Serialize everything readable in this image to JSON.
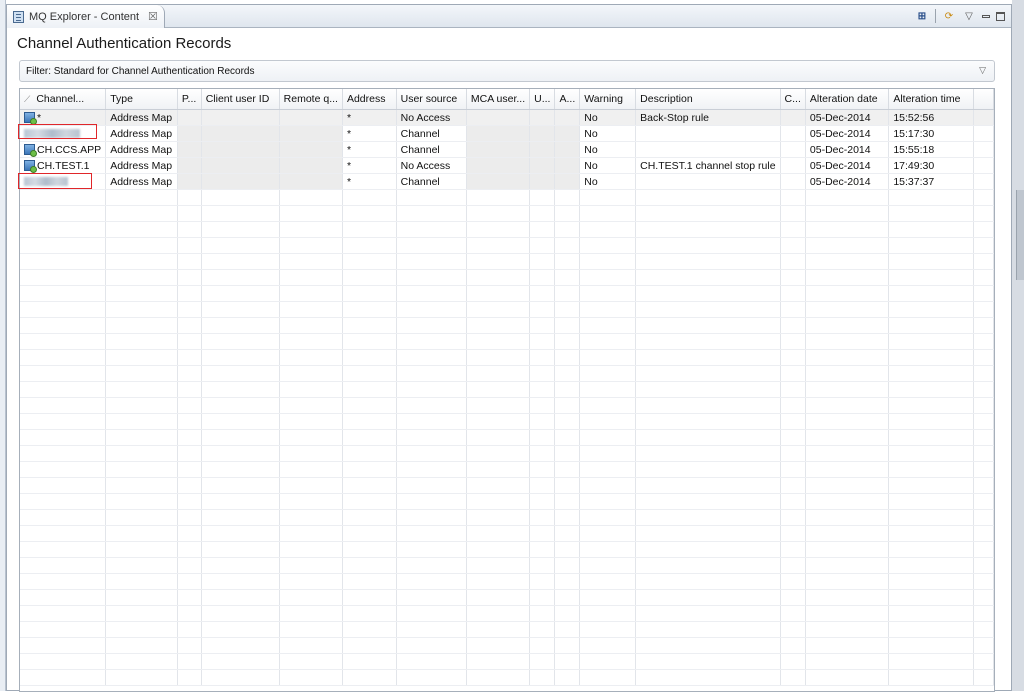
{
  "view": {
    "tab_title": "MQ Explorer - Content",
    "close_glyph": "☒",
    "page_title": "Channel Authentication Records",
    "filter_label": "Filter:  Standard for Channel Authentication Records",
    "toolbar_icons": [
      "column-config-icon",
      "refresh-icon",
      "view-menu-icon",
      "minimize-icon",
      "maximize-icon"
    ]
  },
  "table": {
    "columns": [
      "Channel...",
      "Type",
      "P...",
      "Client user ID",
      "Remote q...",
      "Address",
      "User source",
      "MCA user...",
      "U...",
      "A...",
      "Warning",
      "Description",
      "C...",
      "Alteration date",
      "Alteration time"
    ],
    "rows": [
      {
        "channel": "*",
        "type": "Address Map",
        "address": "*",
        "user_source": "No Access",
        "warning": "No",
        "description": "Back-Stop rule",
        "date": "05-Dec-2014",
        "time": "15:52:56",
        "blurred": false,
        "selected": true
      },
      {
        "channel": "",
        "type": "Address Map",
        "address": "*",
        "user_source": "Channel",
        "warning": "No",
        "description": "",
        "date": "05-Dec-2014",
        "time": "15:17:30",
        "blurred": true,
        "selected": false
      },
      {
        "channel": "CH.CCS.APP",
        "type": "Address Map",
        "address": "*",
        "user_source": "Channel",
        "warning": "No",
        "description": "",
        "date": "05-Dec-2014",
        "time": "15:55:18",
        "blurred": false,
        "selected": false
      },
      {
        "channel": "CH.TEST.1",
        "type": "Address Map",
        "address": "*",
        "user_source": "No Access",
        "warning": "No",
        "description": "CH.TEST.1 channel stop rule",
        "date": "05-Dec-2014",
        "time": "17:49:30",
        "blurred": false,
        "selected": false
      },
      {
        "channel": "",
        "type": "Address Map",
        "address": "*",
        "user_source": "Channel",
        "warning": "No",
        "description": "",
        "date": "05-Dec-2014",
        "time": "15:37:37",
        "blurred": true,
        "selected": false
      }
    ]
  },
  "colors": {
    "highlight_box": "#e0262a",
    "selected_row": "#f0f0f0"
  }
}
